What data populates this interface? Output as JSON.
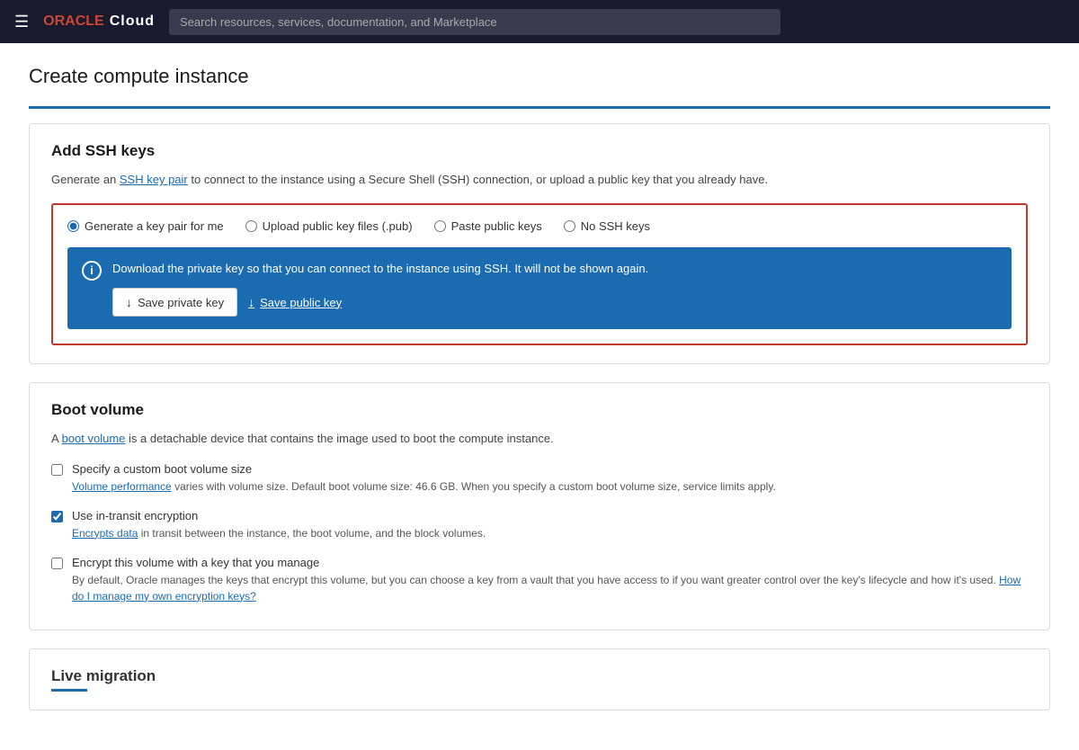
{
  "topbar": {
    "menu_icon": "☰",
    "oracle_label": "ORACLE",
    "cloud_label": "Cloud",
    "search_placeholder": "Search resources, services, documentation, and Marketplace"
  },
  "page": {
    "title": "Create compute instance"
  },
  "ssh_section": {
    "title": "Add SSH keys",
    "description_prefix": "Generate an ",
    "description_link": "SSH key pair",
    "description_suffix": " to connect to the instance using a Secure Shell (SSH) connection, or upload a public key that you already have.",
    "radio_options": [
      {
        "id": "gen-key",
        "label": "Generate a key pair for me",
        "checked": true
      },
      {
        "id": "upload-key",
        "label": "Upload public key files (.pub)",
        "checked": false
      },
      {
        "id": "paste-key",
        "label": "Paste public keys",
        "checked": false
      },
      {
        "id": "no-ssh",
        "label": "No SSH keys",
        "checked": false
      }
    ],
    "info_text": "Download the private key so that you can connect to the instance using SSH. It will not be shown again.",
    "save_private_key_label": "Save private key",
    "save_public_key_label": "Save public key"
  },
  "boot_volume": {
    "title": "Boot volume",
    "description_prefix": "A ",
    "description_link": "boot volume",
    "description_suffix": " is a detachable device that contains the image used to boot the compute instance.",
    "options": [
      {
        "id": "custom-boot",
        "label": "Specify a custom boot volume size",
        "checked": false,
        "description": "Volume performance varies with volume size. Default boot volume size: 46.6 GB. When you specify a custom boot volume size, service limits apply.",
        "description_link": "Volume performance"
      },
      {
        "id": "in-transit",
        "label": "Use in-transit encryption",
        "checked": true,
        "description": "Encrypts data in transit between the instance, the boot volume, and the block volumes.",
        "description_link": "Encrypts data"
      },
      {
        "id": "encrypt-key",
        "label": "Encrypt this volume with a key that you manage",
        "checked": false,
        "description_before": "By default, Oracle manages the keys that encrypt this volume, but you can choose a key from a vault that you have access to if you want greater control over the key's lifecycle and how it's used. ",
        "description_link": "How do I manage my own encryption keys?",
        "description_after": ""
      }
    ]
  },
  "live_migration": {
    "title": "Live migration"
  }
}
